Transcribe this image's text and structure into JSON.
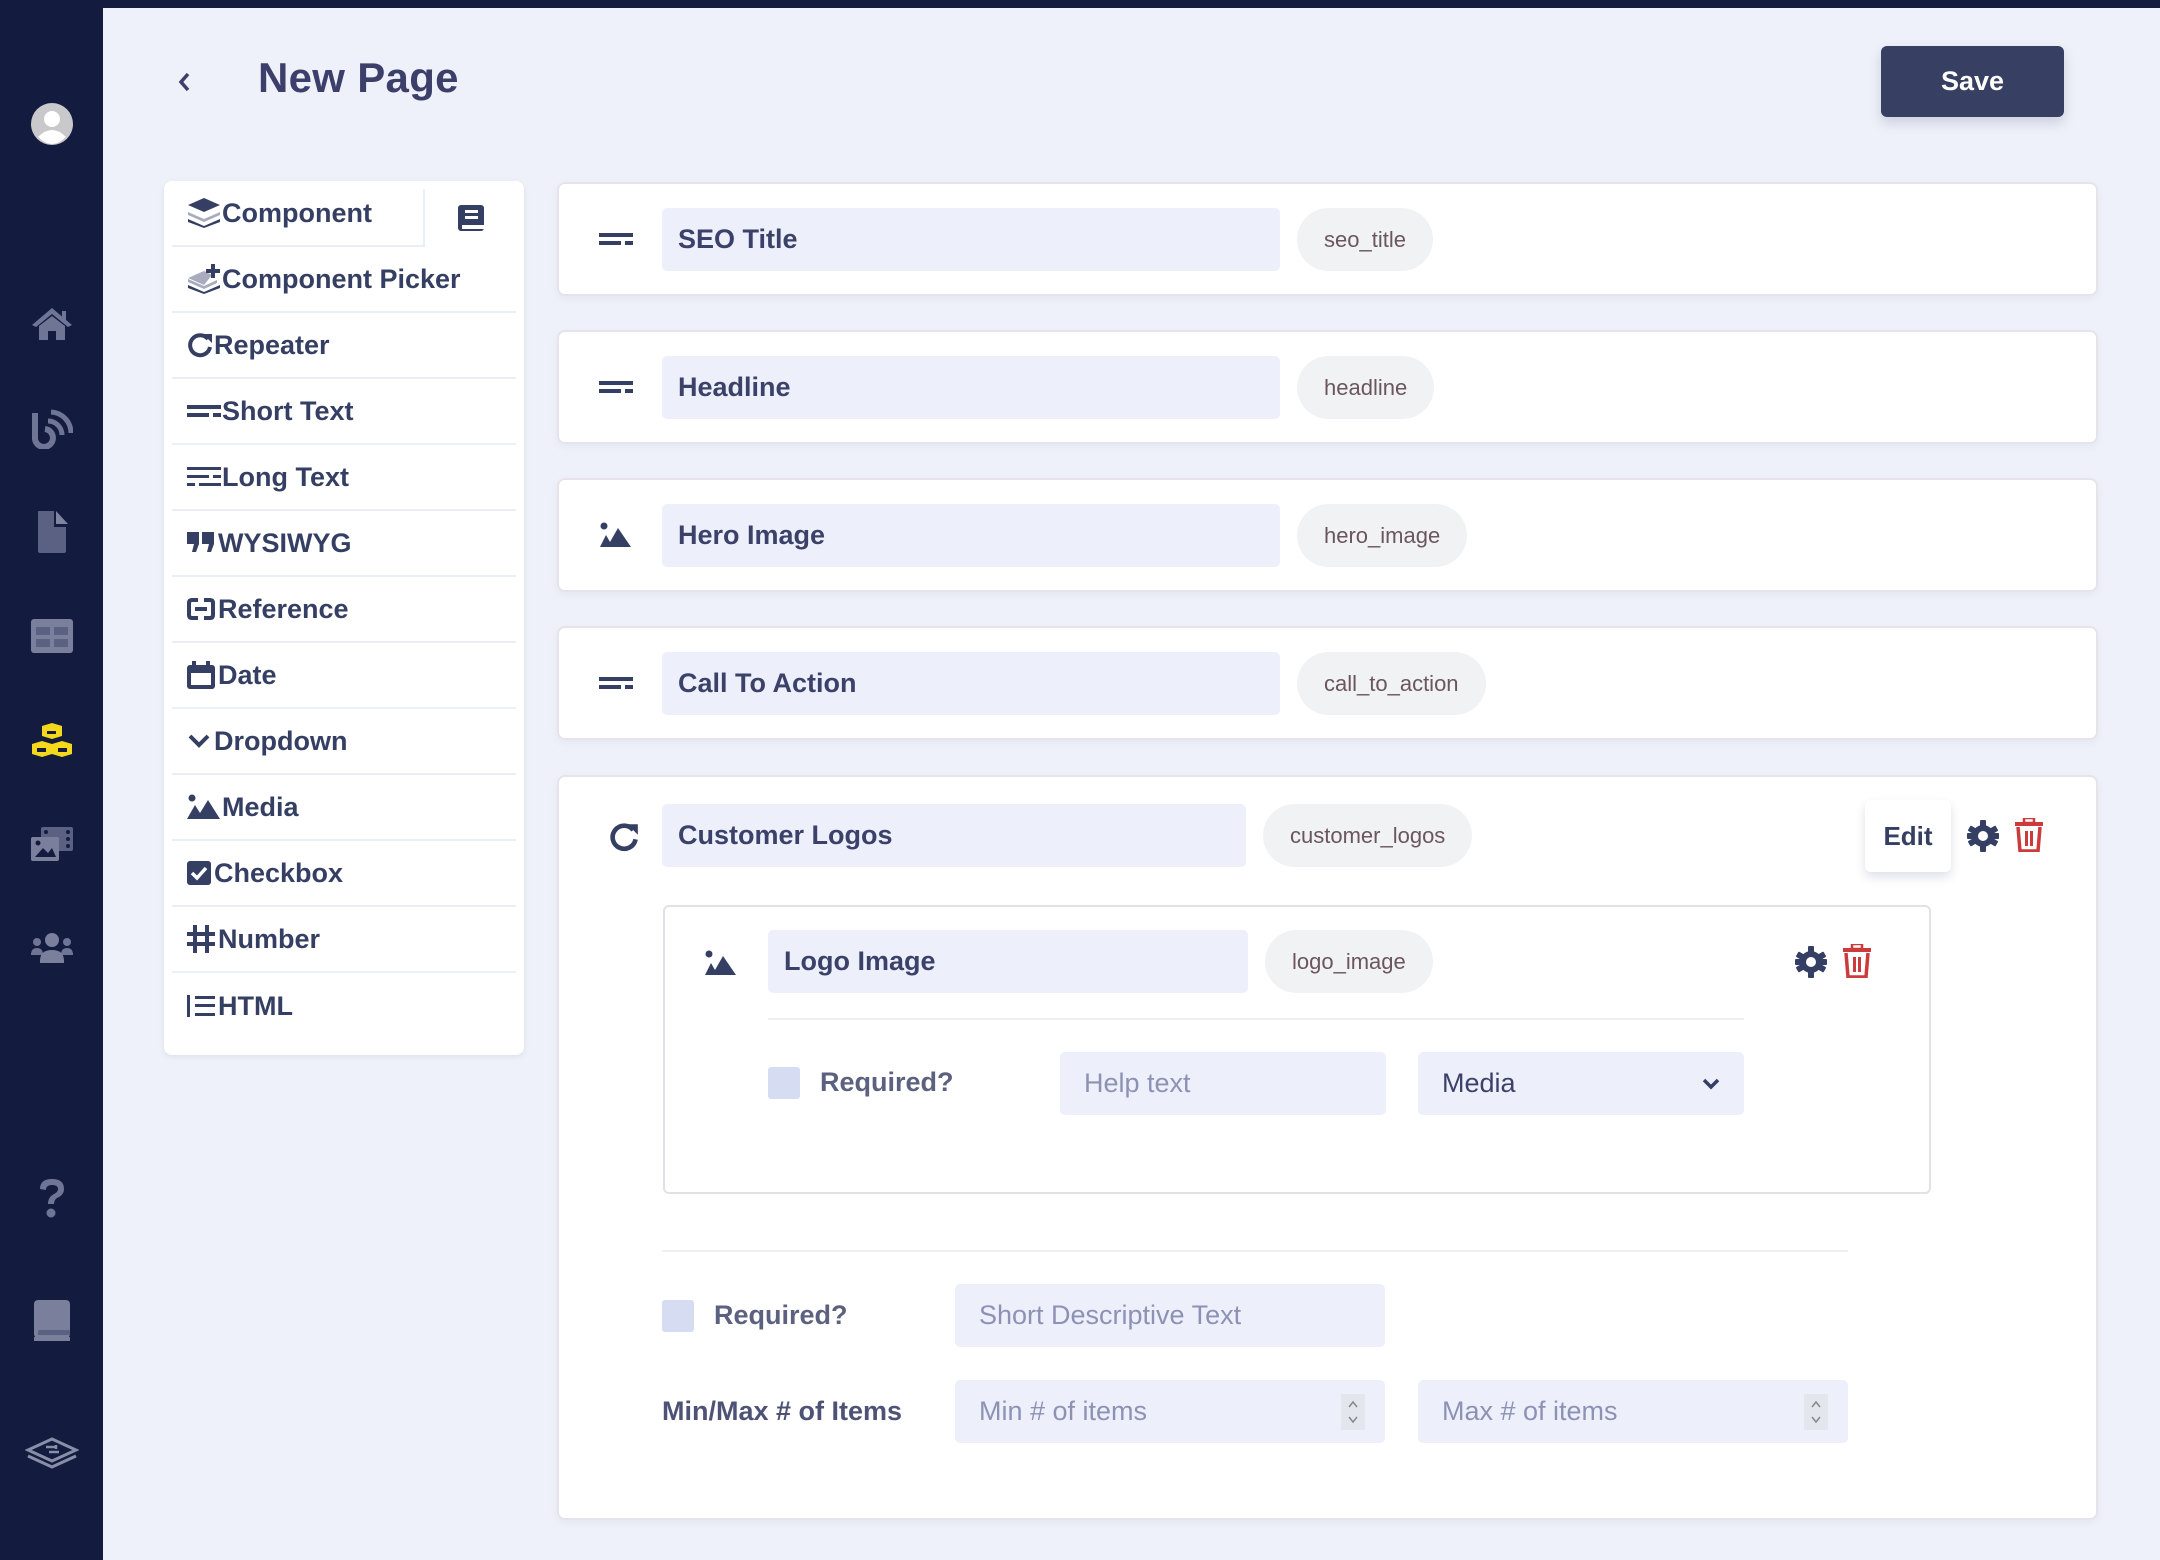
{
  "header": {
    "title": "New Page",
    "save_label": "Save",
    "back_icon": "chevron-left-icon"
  },
  "sidebar": {
    "items": [
      {
        "name": "avatar",
        "icon": "user-avatar-icon",
        "active": false
      },
      {
        "name": "home",
        "icon": "home-icon",
        "active": false
      },
      {
        "name": "blog",
        "icon": "blog-feed-icon",
        "active": false
      },
      {
        "name": "pages",
        "icon": "file-icon",
        "active": false
      },
      {
        "name": "layouts",
        "icon": "grid-table-icon",
        "active": false
      },
      {
        "name": "components",
        "icon": "cubes-icon",
        "active": true
      },
      {
        "name": "media",
        "icon": "media-gallery-icon",
        "active": false
      },
      {
        "name": "users",
        "icon": "users-icon",
        "active": false
      },
      {
        "name": "help",
        "icon": "question-icon",
        "active": false
      },
      {
        "name": "docs",
        "icon": "book-icon",
        "active": false
      },
      {
        "name": "brand",
        "icon": "logo-icon",
        "active": false
      }
    ],
    "active_color": "#f5d81c"
  },
  "component_panel": {
    "items": [
      {
        "label": "Component",
        "icon": "layers-icon"
      },
      {
        "label": "Component Picker",
        "icon": "layers-plus-icon"
      },
      {
        "label": "Repeater",
        "icon": "repeat-icon"
      },
      {
        "label": "Short Text",
        "icon": "short-text-icon"
      },
      {
        "label": "Long Text",
        "icon": "long-text-icon"
      },
      {
        "label": "WYSIWYG",
        "icon": "quote-icon"
      },
      {
        "label": "Reference",
        "icon": "link-icon"
      },
      {
        "label": "Date",
        "icon": "calendar-icon"
      },
      {
        "label": "Dropdown",
        "icon": "chevron-down-icon"
      },
      {
        "label": "Media",
        "icon": "image-icon"
      },
      {
        "label": "Checkbox",
        "icon": "checkbox-icon"
      },
      {
        "label": "Number",
        "icon": "hashtag-icon"
      },
      {
        "label": "HTML",
        "icon": "list-icon"
      }
    ],
    "docs_icon": "book-icon"
  },
  "fields": [
    {
      "type": "short-text",
      "icon": "short-text-icon",
      "label": "SEO Title",
      "key": "seo_title"
    },
    {
      "type": "short-text",
      "icon": "short-text-icon",
      "label": "Headline",
      "key": "headline"
    },
    {
      "type": "media",
      "icon": "image-icon",
      "label": "Hero Image",
      "key": "hero_image"
    },
    {
      "type": "short-text",
      "icon": "short-text-icon",
      "label": "Call To Action",
      "key": "call_to_action"
    }
  ],
  "repeater": {
    "icon": "repeat-icon",
    "label": "Customer Logos",
    "key": "customer_logos",
    "edit_label": "Edit",
    "nested": {
      "icon": "image-icon",
      "label": "Logo Image",
      "key": "logo_image",
      "required_label": "Required?",
      "required": false,
      "help_placeholder": "Help text",
      "type_selected": "Media"
    },
    "required_label": "Required?",
    "required": false,
    "description_placeholder": "Short Descriptive Text",
    "minmax_label": "Min/Max # of Items",
    "min_placeholder": "Min # of items",
    "max_placeholder": "Max # of items"
  },
  "colors": {
    "sidebar_bg": "#131b3f",
    "primary": "#373f62",
    "danger": "#cc3b3b",
    "input_bg": "#edf0fb"
  }
}
